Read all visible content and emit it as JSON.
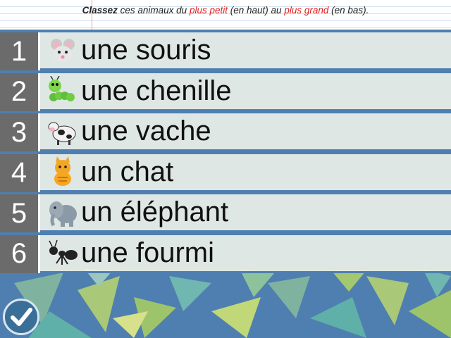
{
  "instruction": {
    "strong": "Classez",
    "part1": " ces animaux du ",
    "red1": "plus petit",
    "part2": " (en haut) au ",
    "red2": "plus grand",
    "part3": " (en bas)."
  },
  "items": [
    {
      "number": "1",
      "label": "une souris",
      "icon": "mouse-icon"
    },
    {
      "number": "2",
      "label": "une chenille",
      "icon": "caterpillar-icon"
    },
    {
      "number": "3",
      "label": "une vache",
      "icon": "cow-icon"
    },
    {
      "number": "4",
      "label": "un chat",
      "icon": "cat-icon"
    },
    {
      "number": "5",
      "label": "un éléphant",
      "icon": "elephant-icon"
    },
    {
      "number": "6",
      "label": "une fourmi",
      "icon": "ant-icon"
    }
  ],
  "check_button": {
    "icon": "checkmark-icon"
  },
  "colors": {
    "accent_red": "#e02020",
    "background_blue": "#4f7fb0",
    "number_gray": "#6b6b6b"
  }
}
